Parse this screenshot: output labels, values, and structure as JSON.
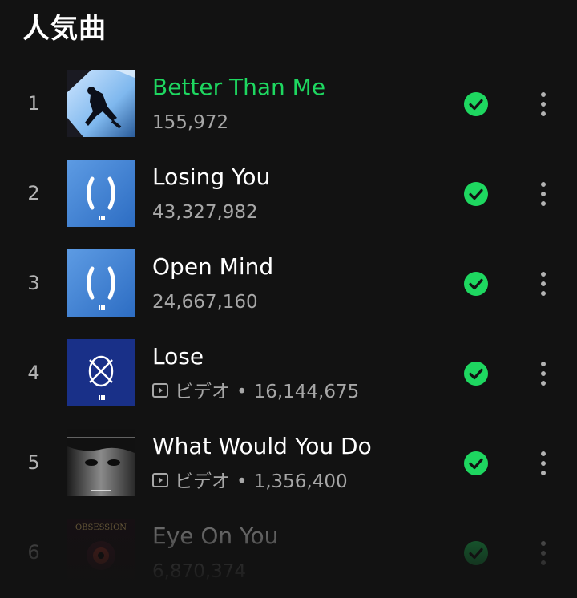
{
  "section": {
    "title": "人気曲"
  },
  "tracks": [
    {
      "rank": "1",
      "title": "Better Than Me",
      "plays": "155,972",
      "is_video": false,
      "video_label": "",
      "is_playing": true,
      "downloaded": true,
      "cover": "cover-dancer"
    },
    {
      "rank": "2",
      "title": "Losing You",
      "plays": "43,327,982",
      "is_video": false,
      "video_label": "",
      "is_playing": false,
      "downloaded": true,
      "cover": "cover-blue-parens"
    },
    {
      "rank": "3",
      "title": "Open Mind",
      "plays": "24,667,160",
      "is_video": false,
      "video_label": "",
      "is_playing": false,
      "downloaded": true,
      "cover": "cover-blue-parens"
    },
    {
      "rank": "4",
      "title": "Lose",
      "plays": "16,144,675",
      "is_video": true,
      "video_label": "ビデオ",
      "is_playing": false,
      "downloaded": true,
      "cover": "cover-navy-emblem"
    },
    {
      "rank": "5",
      "title": "What Would You Do",
      "plays": "1,356,400",
      "is_video": true,
      "video_label": "ビデオ",
      "is_playing": false,
      "downloaded": true,
      "cover": "cover-portrait"
    },
    {
      "rank": "6",
      "title": "Eye On You",
      "plays": "6,870,374",
      "is_video": false,
      "video_label": "",
      "is_playing": false,
      "downloaded": true,
      "cover": "cover-obsession",
      "cover_text": "OBSESSION"
    }
  ],
  "colors": {
    "background": "#121212",
    "accent_green": "#1ed760",
    "text_primary": "#ffffff",
    "text_secondary": "#a7a7a7"
  },
  "icons": {
    "downloaded": "check-circle-icon",
    "more": "more-options-icon",
    "video": "video-icon"
  }
}
